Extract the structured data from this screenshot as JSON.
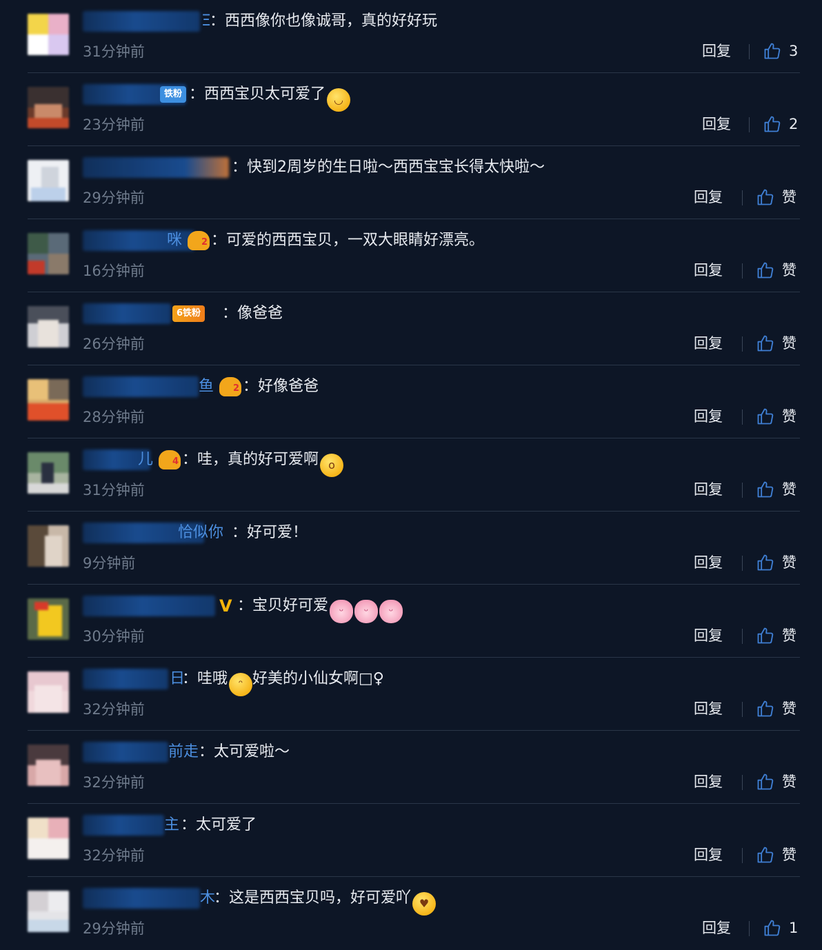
{
  "colors": {
    "background": "#0d1626",
    "divider": "#2a3648",
    "username": "#4c8fe0",
    "timestamp": "#6f7b8c"
  },
  "comments": [
    {
      "name_tail": "Ξ",
      "text": "：西西像你也像诚哥，真的好好玩",
      "time": "31分钟前",
      "reply": "回复",
      "like": "3"
    },
    {
      "name_tail": "",
      "badge": "铁粉",
      "text": "：西西宝贝太可爱了",
      "time": "23分钟前",
      "reply": "回复",
      "like": "2"
    },
    {
      "name_tail": "",
      "text": "：快到2周岁的生日啦～西西宝宝长得太快啦～",
      "time": "29分钟前",
      "reply": "回复",
      "like": "赞"
    },
    {
      "name_tail": "咪",
      "crown": "2",
      "text": "：可爱的西西宝贝，一双大眼睛好漂亮。",
      "time": "16分钟前",
      "reply": "回复",
      "like": "赞"
    },
    {
      "name_tail": "",
      "badge": "6铁粉",
      "text": "：像爸爸",
      "time": "26分钟前",
      "reply": "回复",
      "like": "赞"
    },
    {
      "name_tail": "鱼",
      "crown": "2",
      "text": "：好像爸爸",
      "time": "28分钟前",
      "reply": "回复",
      "like": "赞"
    },
    {
      "name_tail": "儿",
      "crown": "4",
      "text": "：哇，真的好可爱啊",
      "time": "31分钟前",
      "reply": "回复",
      "like": "赞"
    },
    {
      "name_tail": "恰似你",
      "text": "：好可爱！",
      "time": "9分钟前",
      "reply": "回复",
      "like": "赞"
    },
    {
      "name_tail": "V",
      "text": "：宝贝好可爱",
      "time": "30分钟前",
      "reply": "回复",
      "like": "赞"
    },
    {
      "name_tail": "日",
      "text": "：哇哦",
      "text2": "好美的小仙女啊□♀",
      "time": "32分钟前",
      "reply": "回复",
      "like": "赞"
    },
    {
      "name_tail": "前走",
      "text": "：太可爱啦～",
      "time": "32分钟前",
      "reply": "回复",
      "like": "赞"
    },
    {
      "name_tail": "主",
      "text": "：太可爱了",
      "time": "32分钟前",
      "reply": "回复",
      "like": "赞"
    },
    {
      "name_tail": "木",
      "text": "：这是西西宝贝吗，好可爱吖",
      "time": "29分钟前",
      "reply": "回复",
      "like": "1"
    }
  ]
}
